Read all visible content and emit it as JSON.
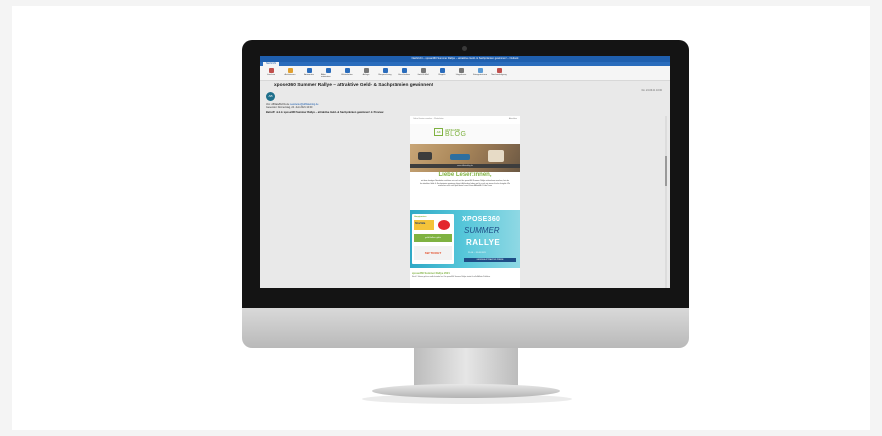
{
  "window": {
    "title": "Nachricht – xpose360 Summer Rallye – attraktive Geld- & Sachprämien gewinnen! – Outlook"
  },
  "ribbon": {
    "active_tab": "Nachricht",
    "buttons": [
      {
        "label": "Löschen",
        "icon": "trash-icon",
        "color": "#c0504d"
      },
      {
        "label": "Archivieren",
        "icon": "archive-icon",
        "color": "#e0a030"
      },
      {
        "label": "Antworten",
        "icon": "reply-icon",
        "color": "#2a6cbc"
      },
      {
        "label": "Allen antworten",
        "icon": "reply-all-icon",
        "color": "#2a6cbc"
      },
      {
        "label": "Weiterleiten",
        "icon": "forward-icon",
        "color": "#2a6cbc"
      },
      {
        "label": "Anlage",
        "icon": "attachment-icon",
        "color": "#777777"
      },
      {
        "label": "Besprechung",
        "icon": "meeting-icon",
        "color": "#2a6cbc"
      },
      {
        "label": "Verschieben",
        "icon": "move-icon",
        "color": "#2a6cbc"
      },
      {
        "label": "Junk-E-Mail",
        "icon": "junk-icon",
        "color": "#777777"
      },
      {
        "label": "Regeln",
        "icon": "rules-icon",
        "color": "#2a6cbc"
      },
      {
        "label": "Ungelesen",
        "icon": "unread-icon",
        "color": "#777777"
      },
      {
        "label": "Kategorisieren",
        "icon": "category-icon",
        "color": "#5b9bd5"
      },
      {
        "label": "Nachverfolgung",
        "icon": "flag-icon",
        "color": "#c0504d"
      }
    ]
  },
  "message": {
    "subject": "xpose360 Summer Rallye – attraktive Geld- & Sachprämien gewinnen!",
    "avatar_initials": "AB",
    "date": "Do. 24.06.21 10:00",
    "from_label": "Von: AffiliateBLOG.de",
    "from_email": "newsletter@affiliateblog.de",
    "sent": "Gesendet: Donnerstag, 24. Juni 2021 10:00",
    "preview": "Betreff: ☀☀☀ xpose360 Summer Rallye – attraktive Geld- & Sachprämien gewinnen! ☀ Preview"
  },
  "newsletter": {
    "toplink_left": "Online-Version ansehen – Weiterleiten",
    "toplink_right": "Abmelden",
    "logo_mark": "A3",
    "logo_line1": "AFFILIATE",
    "logo_line2": "BLOG",
    "site_bar": "www.affiliateblog.de",
    "greeting": "Liebe Leser:innen,",
    "body": "mit dem heutigen Newsletter möchten wir euch auf die xpose360 Summer Rallye aufmerksam machen, bei der ihr attraktive Geld- & Sachprämien gewinnen könnt. Außerdem haben wir für euch wie immer frische Insights. Wir wünschen euch viel Spaß beim Lesen! Euer AffiliateBLOG.de Team",
    "banner": {
      "card_label": "Hauptpartner",
      "card_brand": "Shorfalia",
      "card_text": "gelbGelber gibts",
      "card_ticket": "SW TICKET",
      "title1": "XPOSE360",
      "title2": "SUMMER",
      "title3": "RALLYE",
      "dates": "21.06. – 31.08.2021",
      "cta": "GEWINNE ATTRAKTIVE PREISE"
    },
    "section_title": "xpose360 Summer Rallye 2021",
    "section_text": "Nach 2 Jahren geht es endlich wieder los: Die xpose360 Summer Rallye startet für alle Affiliate Publisher"
  }
}
